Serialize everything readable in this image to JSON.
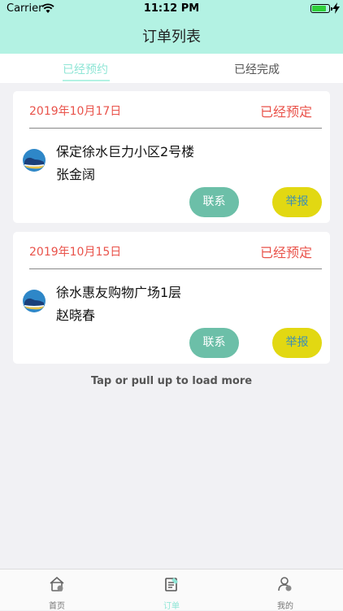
{
  "status_bar": {
    "carrier": "Carrier",
    "time": "11:12 PM",
    "battery_level": 0.9
  },
  "nav": {
    "title": "订单列表"
  },
  "tabs": [
    {
      "label": "已经预约",
      "active": true
    },
    {
      "label": "已经完成",
      "active": false
    }
  ],
  "orders": [
    {
      "date": "2019年10月17日",
      "status": "已经预定",
      "address": "保定徐水巨力小区2号楼",
      "person": "张金阔",
      "contact_label": "联系",
      "report_label": "举报"
    },
    {
      "date": "2019年10月15日",
      "status": "已经预定",
      "address": "徐水惠友购物广场1层",
      "person": "赵晓春",
      "contact_label": "联系",
      "report_label": "举报"
    }
  ],
  "load_more": "Tap or pull up to load more",
  "tabbar": [
    {
      "label": "首页",
      "icon": "home-icon",
      "active": false
    },
    {
      "label": "订单",
      "icon": "order-icon",
      "active": true
    },
    {
      "label": "我的",
      "icon": "profile-icon",
      "active": false
    }
  ],
  "colors": {
    "header_bg": "#b3f2e3",
    "accent": "#8fe6d6",
    "status_red": "#e9524a",
    "contact_btn": "#6cbfa8",
    "report_btn": "#e2d812"
  }
}
